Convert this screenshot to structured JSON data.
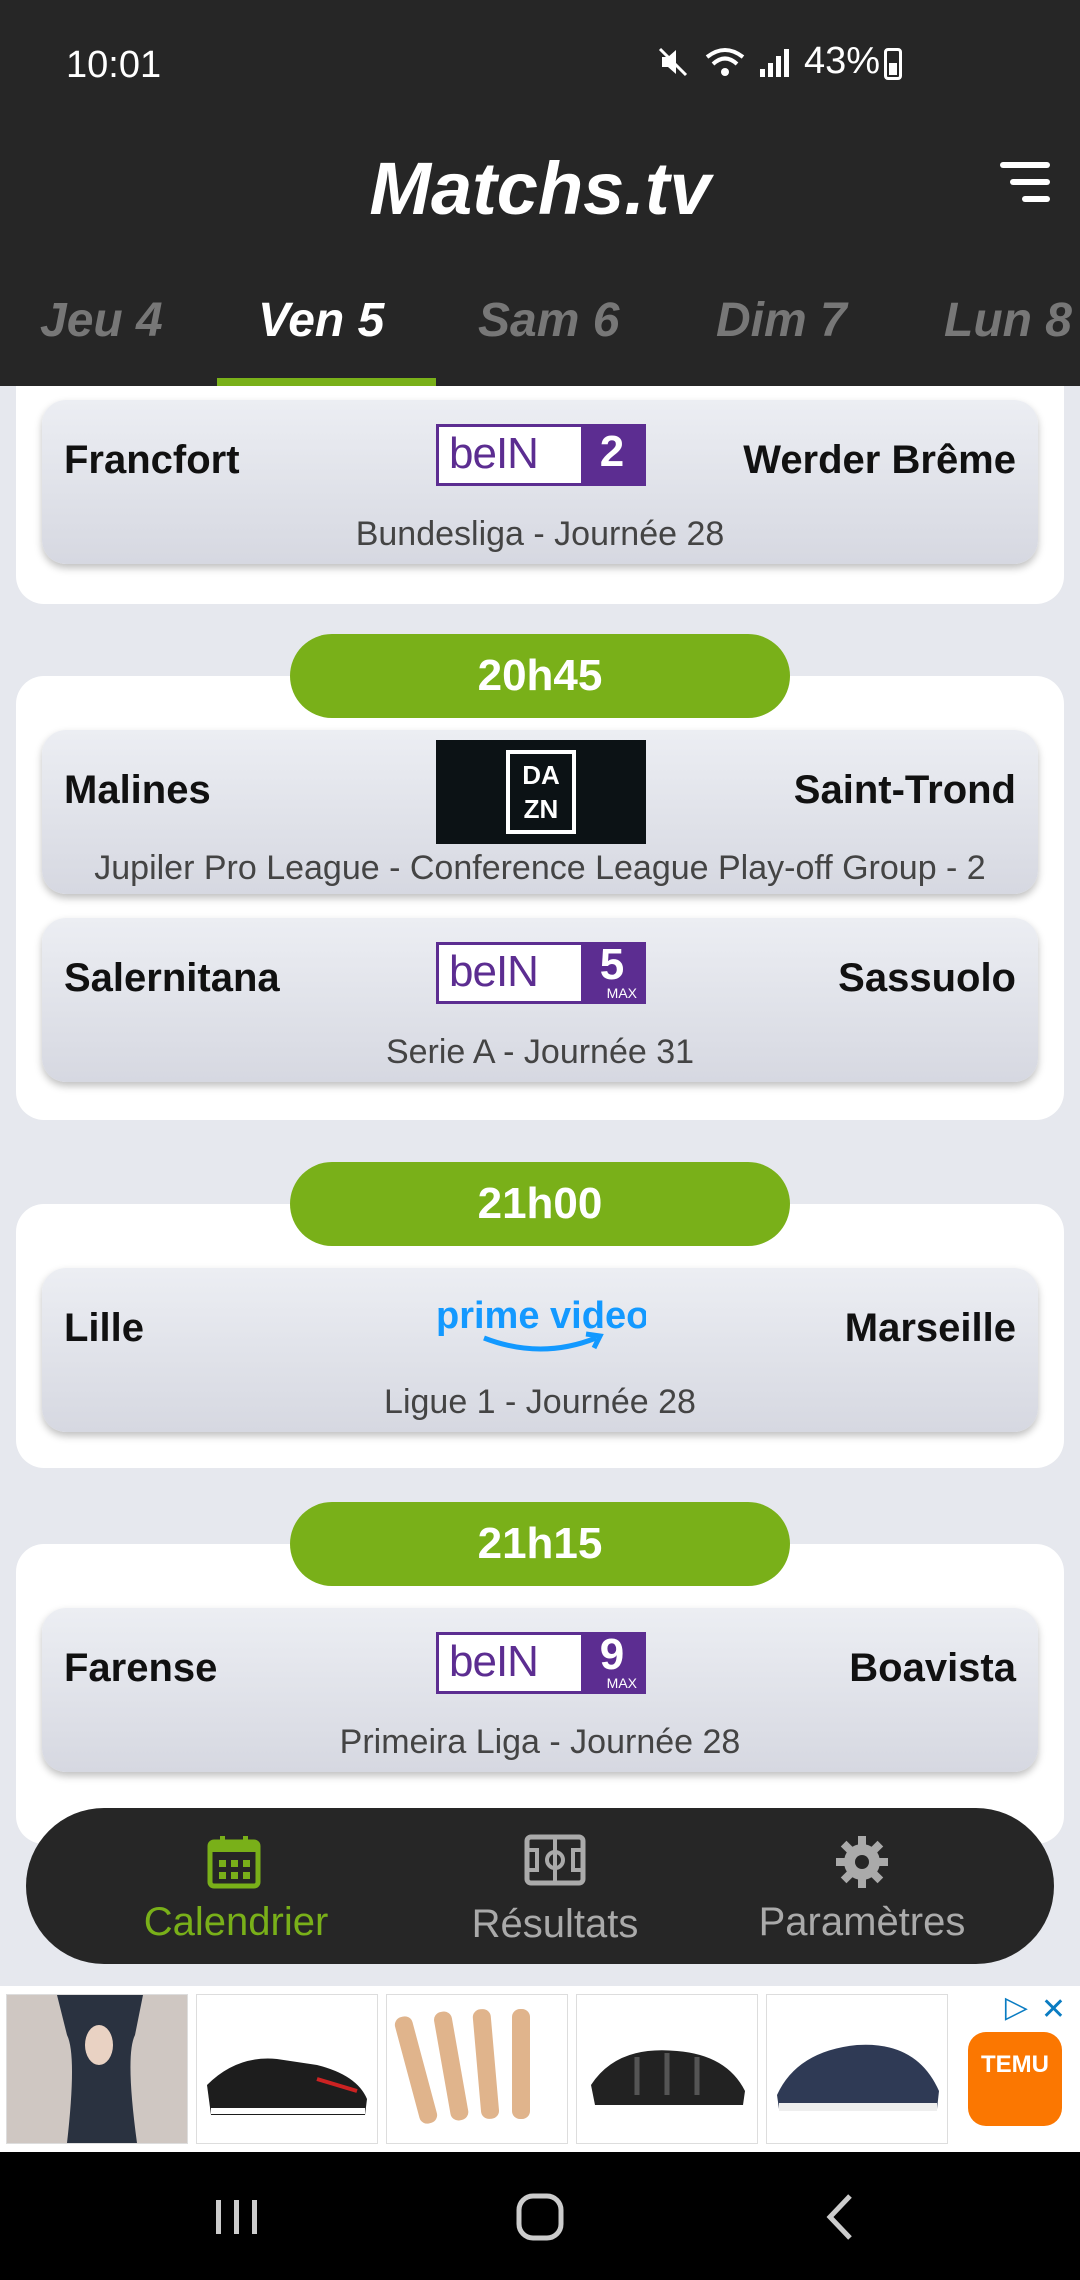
{
  "status": {
    "time": "10:01",
    "battery": "43%"
  },
  "header": {
    "title": "Matchs.tv",
    "filter_icon": "filter-icon"
  },
  "tabs": [
    {
      "label": "Jeu 4",
      "active": false
    },
    {
      "label": "Ven 5",
      "active": true
    },
    {
      "label": "Sam 6",
      "active": false
    },
    {
      "label": "Dim 7",
      "active": false
    },
    {
      "label": "Lun 8",
      "active": false
    }
  ],
  "groups": [
    {
      "time": "",
      "matches": [
        {
          "home": "Francfort",
          "away": "Werder Brême",
          "channel": "beIN 2",
          "channel_number": "2",
          "league": "Bundesliga - Journée 28"
        }
      ]
    },
    {
      "time": "20h45",
      "matches": [
        {
          "home": "Malines",
          "away": "Saint-Trond",
          "channel": "DAZN",
          "channel_text": "DA ZN",
          "league": "Jupiler Pro League - Conference League Play-off Group - 2"
        },
        {
          "home": "Salernitana",
          "away": "Sassuolo",
          "channel": "beIN 5 MAX",
          "channel_number": "5",
          "channel_suffix": "MAX",
          "league": "Serie A - Journée 31"
        }
      ]
    },
    {
      "time": "21h00",
      "matches": [
        {
          "home": "Lille",
          "away": "Marseille",
          "channel": "prime video",
          "league": "Ligue 1 - Journée 28"
        }
      ]
    },
    {
      "time": "21h15",
      "matches": [
        {
          "home": "Farense",
          "away": "Boavista",
          "channel": "beIN 9 MAX",
          "channel_number": "9",
          "channel_suffix": "MAX",
          "league": "Primeira Liga - Journée 28"
        }
      ]
    }
  ],
  "bottom_nav": [
    {
      "label": "Calendrier",
      "icon": "calendar-icon",
      "active": true
    },
    {
      "label": "Résultats",
      "icon": "pitch-icon",
      "active": false
    },
    {
      "label": "Paramètres",
      "icon": "gear-icon",
      "active": false
    }
  ],
  "ad": {
    "brand": "TEMU",
    "items": [
      "bodysuit",
      "sneakers",
      "wooden tools",
      "sandals",
      "slip-on shoes"
    ]
  },
  "colors": {
    "accent": "#79b019",
    "header": "#262626",
    "bein": "#5c2d91",
    "prime": "#1399ff"
  }
}
